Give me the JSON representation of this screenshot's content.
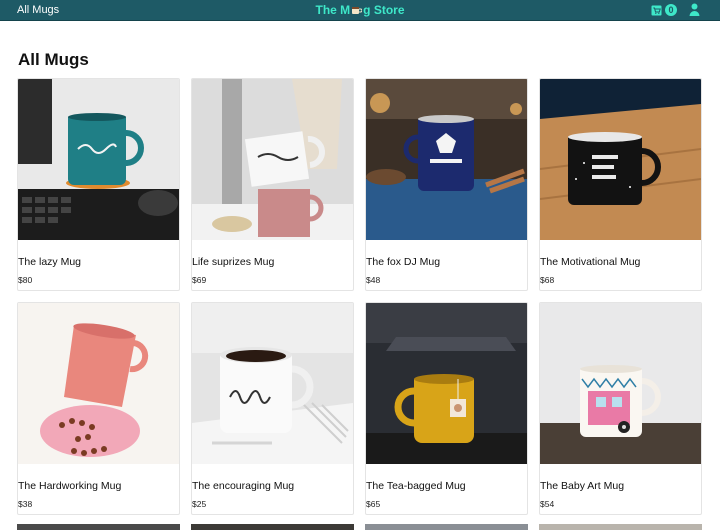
{
  "header": {
    "nav_link": "All Mugs",
    "brand_prefix": "The M",
    "brand_suffix": "g Store",
    "cart_count": "0",
    "colors": {
      "bar": "#1e5a66",
      "accent": "#3ee8c9"
    }
  },
  "page": {
    "title": "All Mugs"
  },
  "products": [
    {
      "name": "The lazy Mug",
      "price": "$80"
    },
    {
      "name": "Life suprizes Mug",
      "price": "$69"
    },
    {
      "name": "The fox DJ Mug",
      "price": "$48"
    },
    {
      "name": "The Motivational Mug",
      "price": "$68"
    },
    {
      "name": "The Hardworking Mug",
      "price": "$38"
    },
    {
      "name": "The encouraging Mug",
      "price": "$25"
    },
    {
      "name": "The Tea-bagged Mug",
      "price": "$65"
    },
    {
      "name": "The Baby Art Mug",
      "price": "$54"
    }
  ],
  "icons": {
    "cart": "shopping-cart-icon",
    "user": "user-icon",
    "brand_mug": "mug-icon"
  }
}
